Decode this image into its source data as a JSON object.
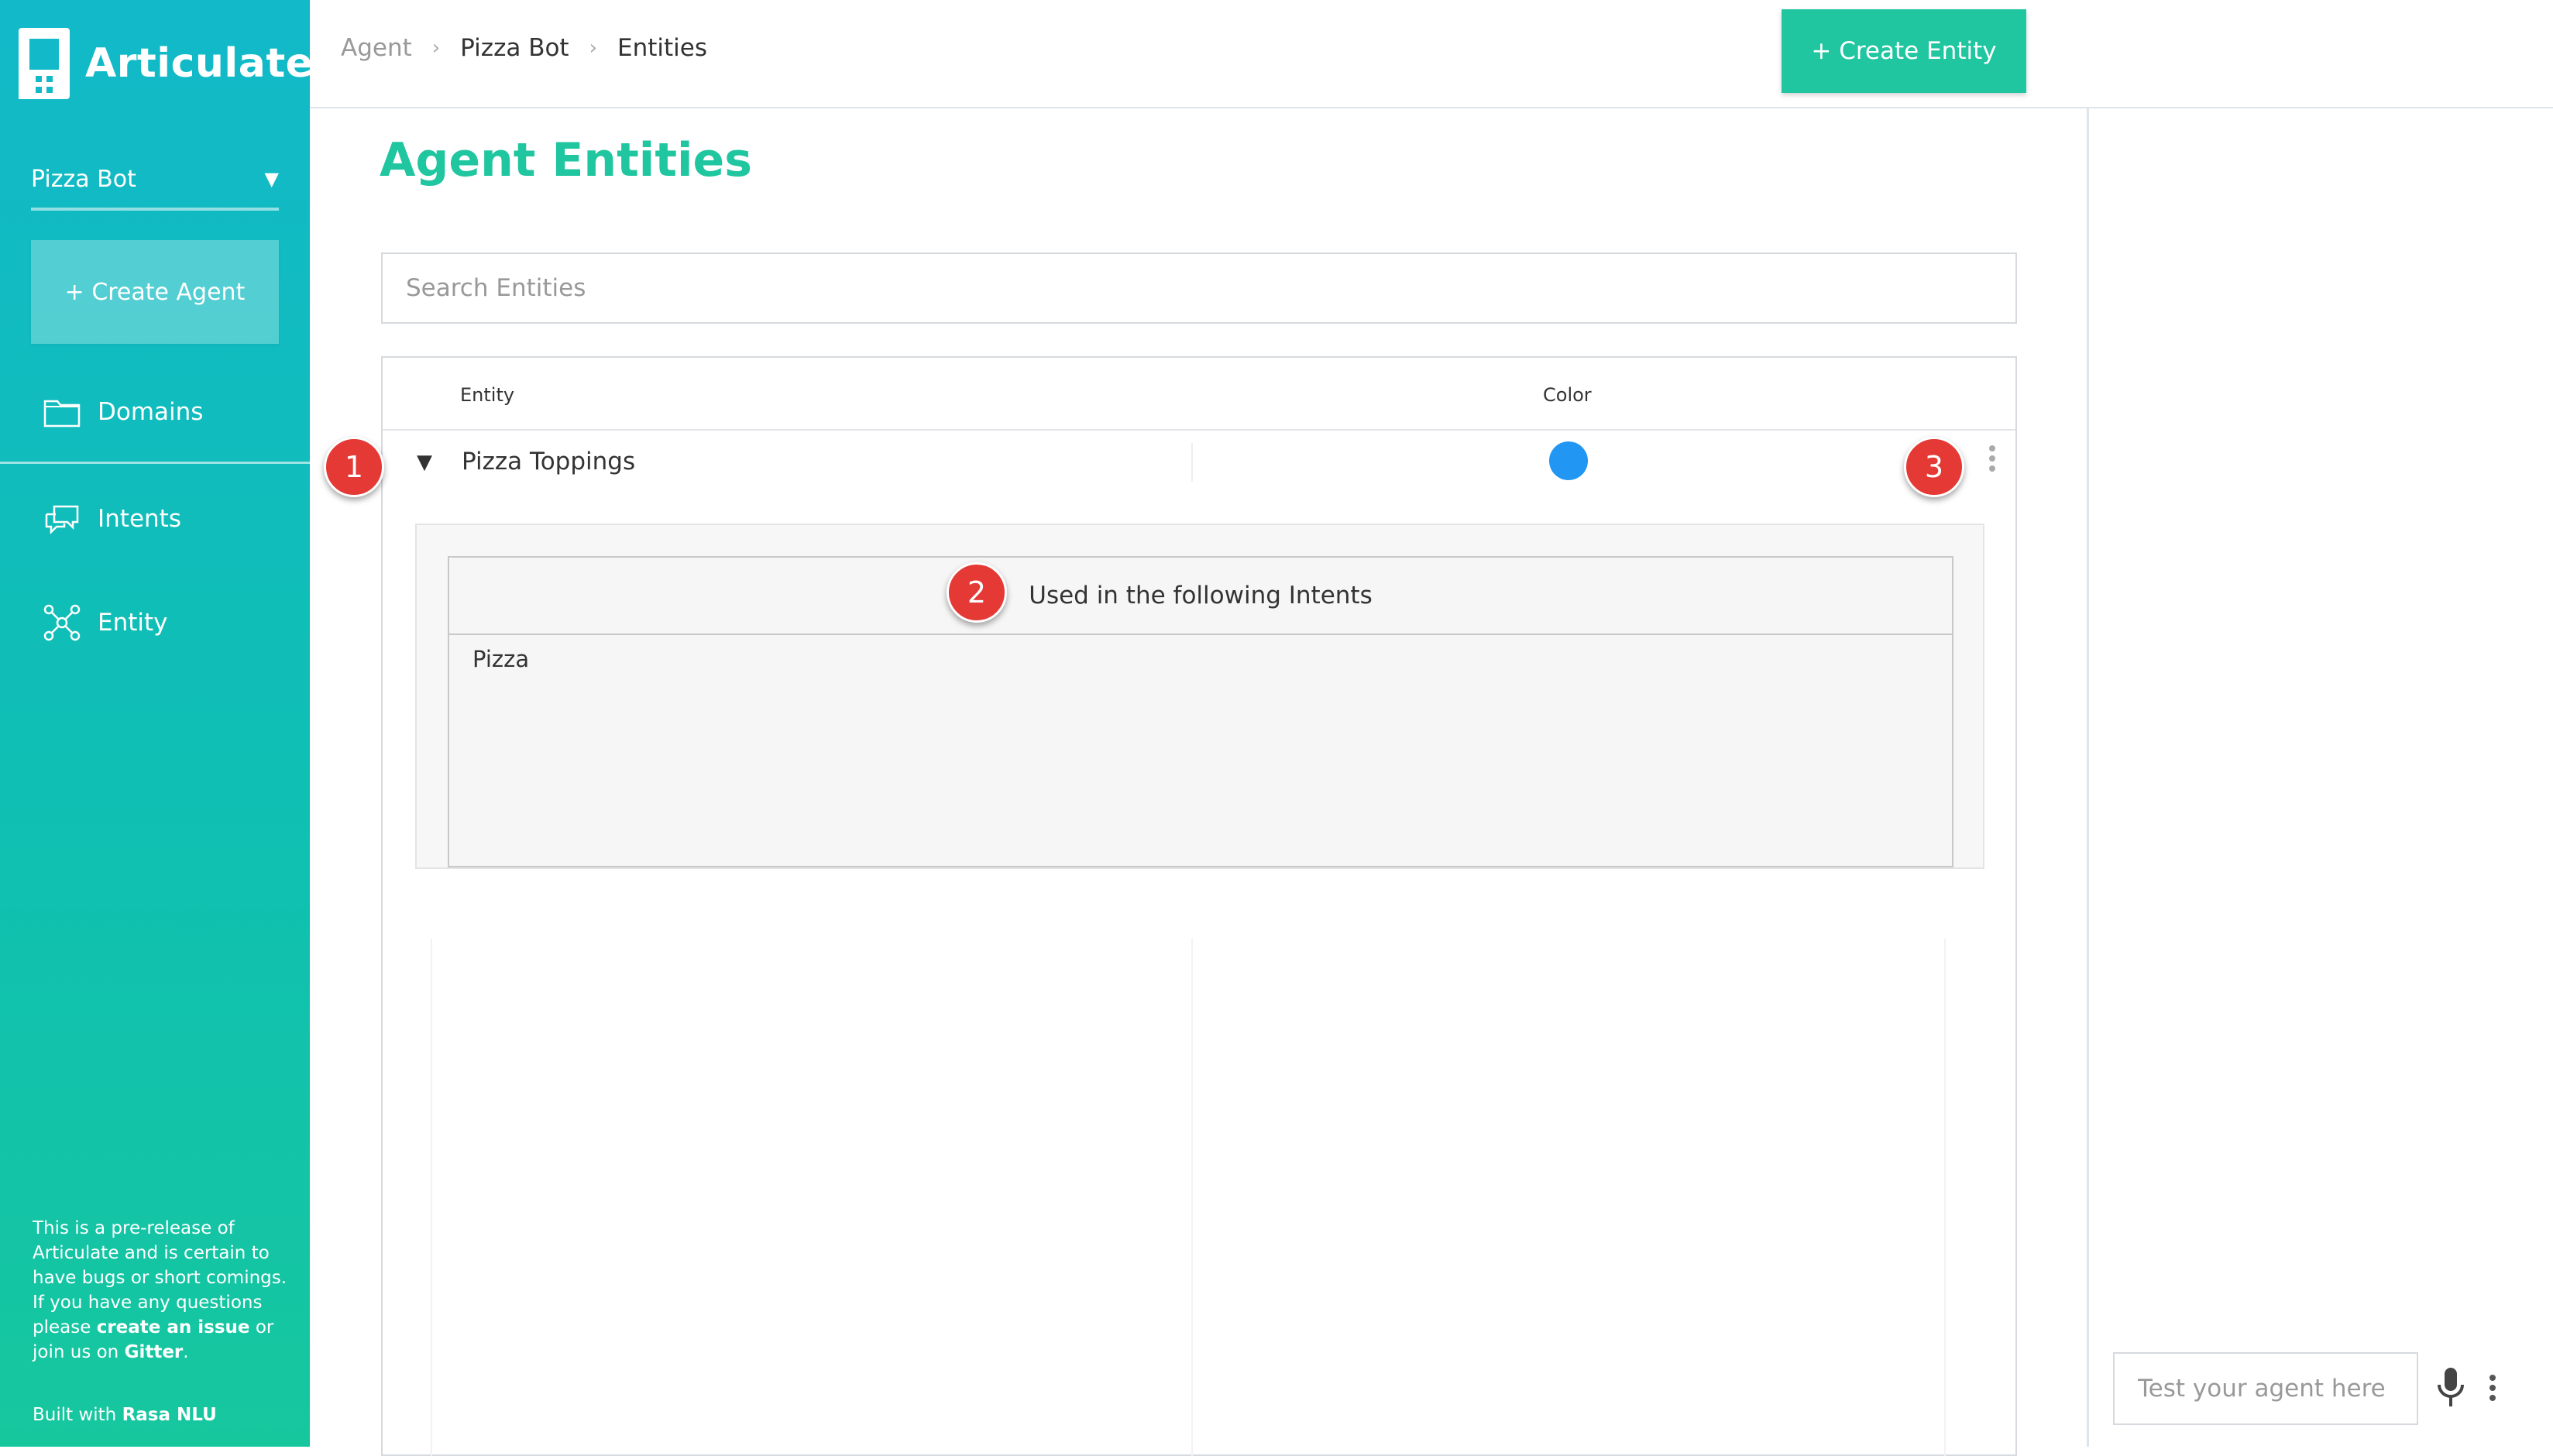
{
  "app": {
    "name": "Articulate",
    "logo_icon": "articulate-logo-icon"
  },
  "sidebar": {
    "agent_select": {
      "value": "Pizza Bot",
      "caret": "▼"
    },
    "create_agent_label": "+ Create Agent",
    "items": [
      {
        "label": "Domains",
        "icon": "folder-icon"
      },
      {
        "label": "Intents",
        "icon": "chat-bubbles-icon"
      },
      {
        "label": "Entity",
        "icon": "entity-network-icon"
      }
    ],
    "note": {
      "text_1": "This is a pre-release of Articulate and is certain to have bugs or short comings. If you have any questions please ",
      "link_issue": "create an issue",
      "text_2": " or join us on ",
      "link_gitter": "Gitter",
      "text_3": "."
    },
    "built_with": {
      "prefix": "Built with ",
      "name": "Rasa NLU"
    }
  },
  "header": {
    "breadcrumbs": [
      "Agent",
      "Pizza Bot",
      "Entities"
    ],
    "separator": "›",
    "create_entity_label": "+ Create Entity"
  },
  "main": {
    "title": "Agent Entities",
    "search_placeholder": "Search Entities",
    "table": {
      "columns": [
        "Entity",
        "Color"
      ],
      "rows": [
        {
          "toggle": "▼",
          "name": "Pizza Toppings",
          "color": "#2196f3",
          "expanded": {
            "header": "Used in the following Intents",
            "intents": [
              "Pizza"
            ]
          }
        }
      ]
    }
  },
  "badges": [
    "1",
    "2",
    "3"
  ],
  "test_panel": {
    "placeholder": "Test your agent here",
    "mic_icon": "microphone-icon",
    "more_icon": "more-vert-icon"
  },
  "colors": {
    "accent": "#1fc69f",
    "sidebar_top": "#12b9c9",
    "sidebar_bottom": "#16c79e",
    "badge": "#e53935"
  }
}
